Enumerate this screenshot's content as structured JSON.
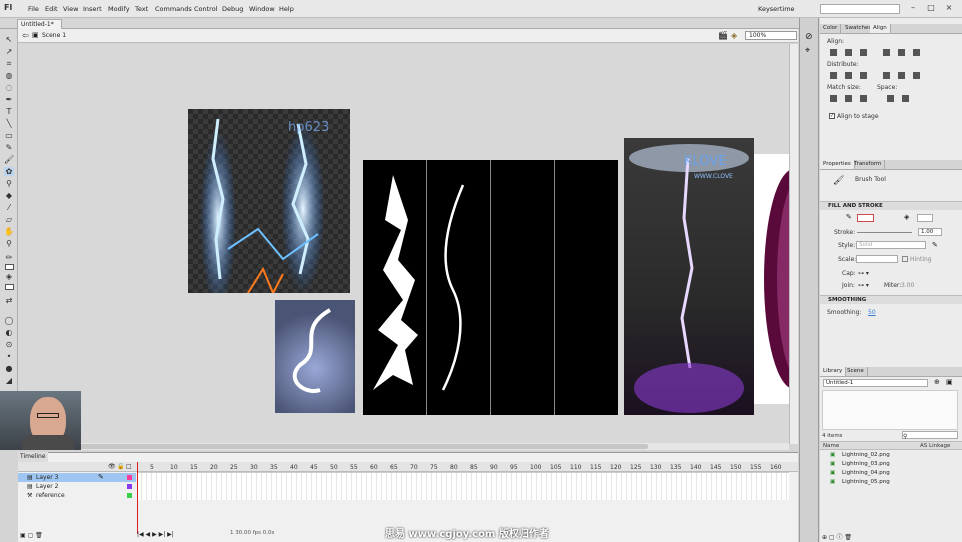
{
  "app": {
    "logo": "Fl",
    "workspace": "Keysertime"
  },
  "menu": [
    "File",
    "Edit",
    "View",
    "Insert",
    "Modify",
    "Text",
    "Commands",
    "Control",
    "Debug",
    "Window",
    "Help"
  ],
  "document": {
    "tab": "Untitled-1*",
    "scene": "Scene 1",
    "zoom": "100%"
  },
  "panel_tabs_top": [
    "Color",
    "Swatches",
    "Align"
  ],
  "align": {
    "title": "Align:",
    "distribute": "Distribute:",
    "match_size": "Match size:",
    "space": "Space:",
    "align_to_stage": "Align to stage"
  },
  "properties": {
    "tabs": [
      "Properties",
      "Transform"
    ],
    "tool_name": "Brush Tool",
    "section_fill": "FILL AND STROKE",
    "stroke_label": "Stroke:",
    "stroke_value": "1.00",
    "style_label": "Style:",
    "style_value": "Solid",
    "scale_label": "Scale:",
    "hinting": "Hinting",
    "cap_label": "Cap:",
    "join_label": "Join:",
    "miter_label": "Miter:",
    "miter_value": "3.00",
    "section_smoothing": "SMOOTHING",
    "smoothing_label": "Smoothing:",
    "smoothing_value": "50"
  },
  "library": {
    "tabs": [
      "Library",
      "Scene"
    ],
    "doc": "Untitled-1",
    "count": "4 items",
    "col_name": "Name",
    "col_link": "AS Linkage",
    "items": [
      "Lightning_02.png",
      "Lightning_03.png",
      "Lightning_04.png",
      "Lightning_05.png"
    ]
  },
  "timeline": {
    "tab": "Timeline",
    "frames": [
      "5",
      "10",
      "15",
      "20",
      "25",
      "30",
      "35",
      "40",
      "45",
      "50",
      "55",
      "60",
      "65",
      "70",
      "75",
      "80",
      "85",
      "90",
      "95",
      "100",
      "105",
      "110",
      "115",
      "120",
      "125",
      "130",
      "135",
      "140",
      "145",
      "150",
      "155",
      "160"
    ],
    "layers": [
      "Layer 3",
      "Layer 2",
      "reference"
    ],
    "status": "1   30.00 fps   0.0s"
  },
  "stage_text": {
    "wm1": "hp623",
    "wm2": "KLOVE",
    "wm3": "WWW.CLOVE"
  },
  "watermark": "思易 www.cgjoy.com 版权归作者",
  "colors": {
    "accent": "#3a7bd5",
    "selected": "#9ec6f0"
  }
}
